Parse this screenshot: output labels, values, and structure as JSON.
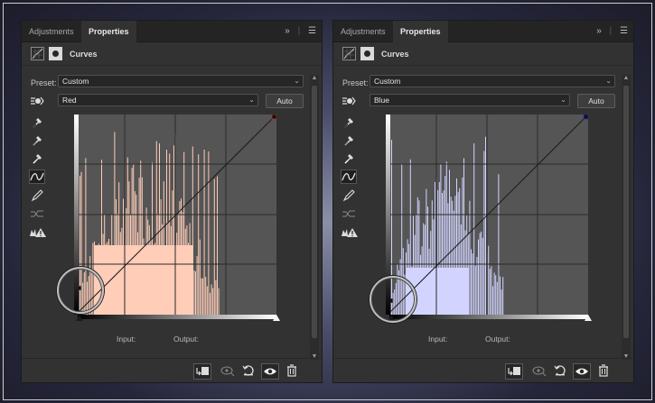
{
  "panels": [
    {
      "tabs": [
        {
          "label": "Adjustments"
        },
        {
          "label": "Properties"
        }
      ],
      "title": "Curves",
      "preset_label": "Preset:",
      "preset_value": "Custom",
      "channel_value": "Red",
      "auto_label": "Auto",
      "input_label": "Input:",
      "output_label": "Output:",
      "curve_color": "#c0392b",
      "histogram_color": "#ffcdb8"
    },
    {
      "tabs": [
        {
          "label": "Adjustments"
        },
        {
          "label": "Properties"
        }
      ],
      "title": "Curves",
      "preset_label": "Preset:",
      "preset_value": "Custom",
      "channel_value": "Blue",
      "auto_label": "Auto",
      "input_label": "Input:",
      "output_label": "Output:",
      "curve_color": "#2c35c9",
      "histogram_color": "#d2d4ff"
    }
  ],
  "icons": {
    "menu_expand": "double-chevron-right-icon",
    "panel_menu": "hamburger-icon",
    "tools": [
      "on-image-adjust-icon",
      "black-point-eyedropper-icon",
      "gray-point-eyedropper-icon",
      "white-point-eyedropper-icon",
      "curve-points-icon",
      "pencil-icon",
      "smooth-icon",
      "clipping-warning-icon"
    ],
    "bottom": [
      "clip-to-layer-icon",
      "view-previous-icon",
      "reset-icon",
      "visibility-eye-icon",
      "trash-icon"
    ]
  }
}
